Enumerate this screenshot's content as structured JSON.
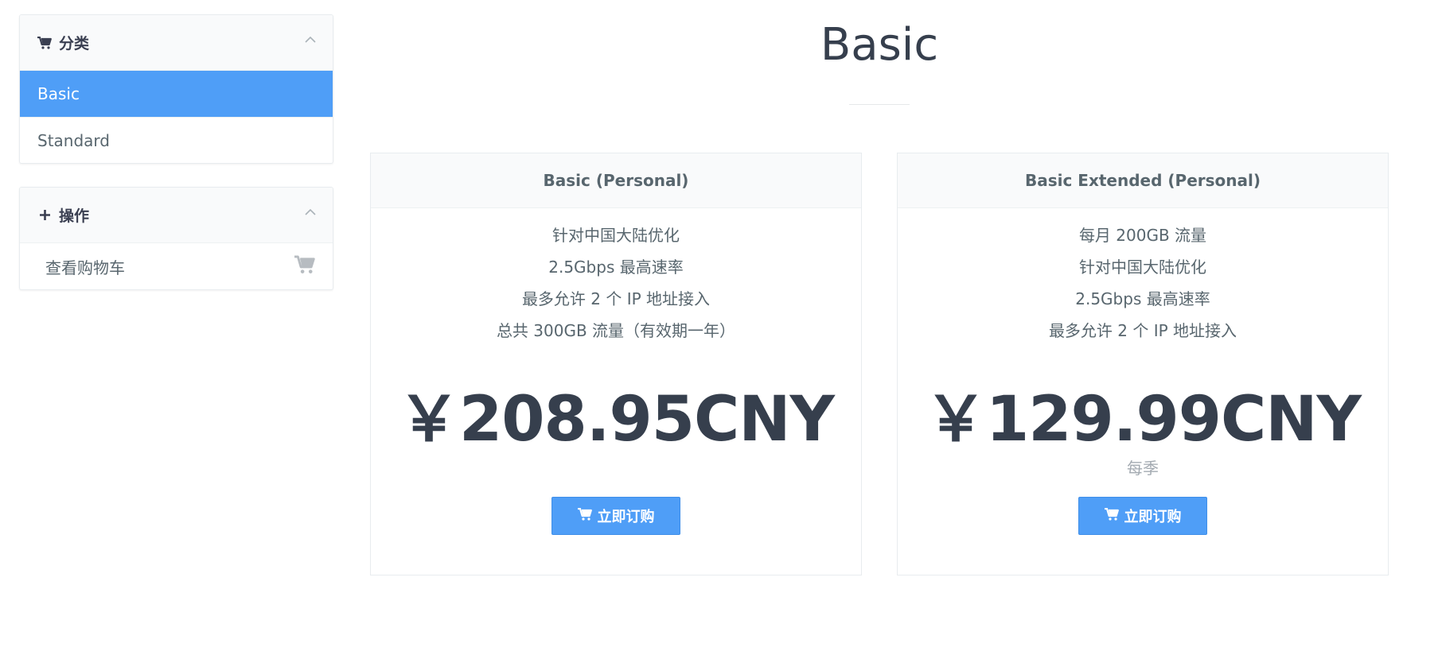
{
  "sidebar": {
    "categories": {
      "title": "分类",
      "icon": "cart-icon",
      "items": [
        {
          "label": "Basic",
          "active": true
        },
        {
          "label": "Standard",
          "active": false
        }
      ]
    },
    "actions": {
      "title": "操作",
      "icon": "plus-icon",
      "items": [
        {
          "label": "查看购物车",
          "icon": "cart-icon"
        }
      ]
    }
  },
  "main": {
    "title": "Basic",
    "products": [
      {
        "name": "Basic (Personal)",
        "features": [
          "针对中国大陆优化",
          "2.5Gbps 最高速率",
          "最多允许 2 个 IP 地址接入",
          "总共 300GB 流量（有效期一年）"
        ],
        "price": "￥208.95CNY",
        "cycle": "",
        "order_label": "立即订购"
      },
      {
        "name": "Basic Extended (Personal)",
        "features": [
          "每月 200GB 流量",
          "针对中国大陆优化",
          "2.5Gbps 最高速率",
          "最多允许 2 个 IP 地址接入"
        ],
        "price": "￥129.99CNY",
        "cycle": "每季",
        "order_label": "立即订购"
      }
    ]
  },
  "colors": {
    "accent": "#4f9ef7",
    "heading": "#363f4d",
    "text": "#58666e",
    "muted": "#a3aab1"
  }
}
